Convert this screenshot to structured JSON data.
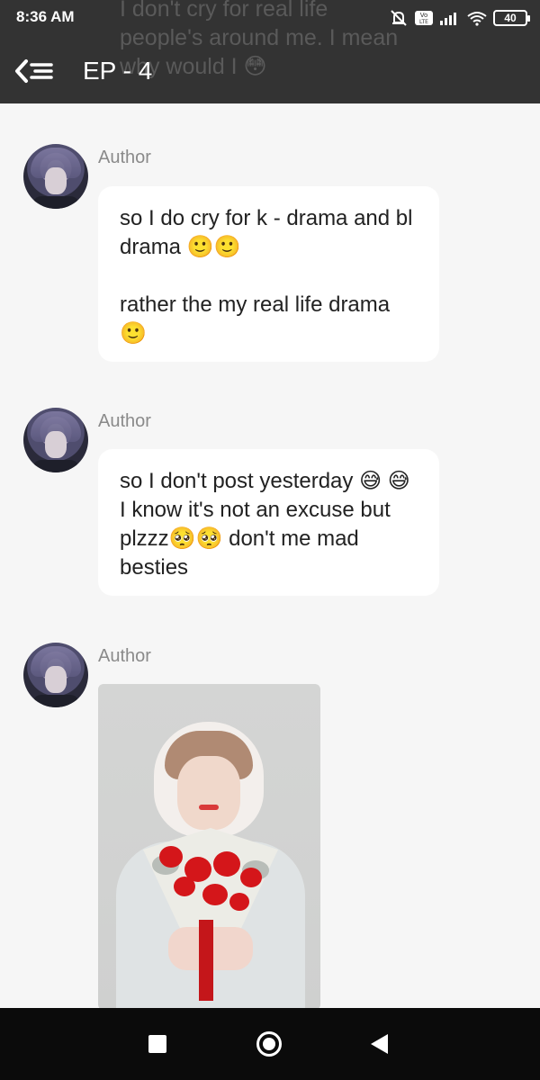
{
  "status_bar": {
    "time": "8:36 AM",
    "battery": "40"
  },
  "header": {
    "title": "EP - 4",
    "ghost_text": "I don't cry for real life\npeople's around me. I mean\nwhy would I 😳"
  },
  "messages": [
    {
      "author": "Author",
      "paragraphs": [
        "so I do cry for k - drama and bl drama 🙂🙂",
        "rather the my real life drama 🙂"
      ]
    },
    {
      "author": "Author",
      "paragraphs": [
        "so I don't post yesterday 😅 😅 I know it's not an excuse but plzzz🥺🥺 don't me mad besties"
      ]
    },
    {
      "author": "Author",
      "image": "photo of a person holding a bouquet of red flowers"
    }
  ]
}
